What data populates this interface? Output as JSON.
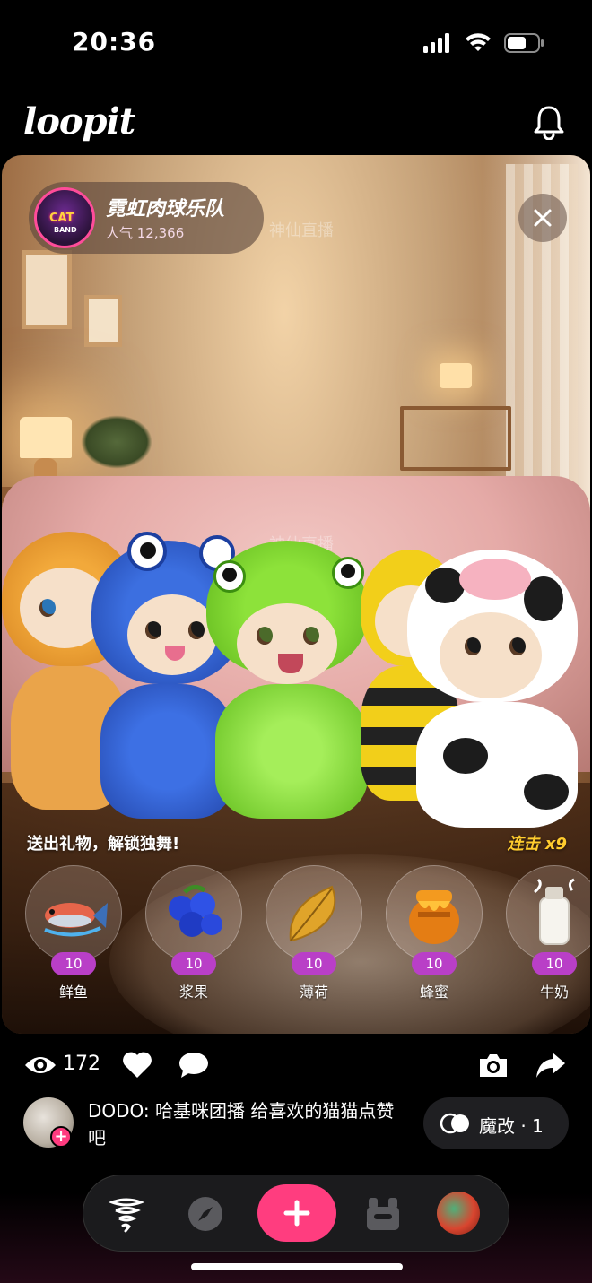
{
  "status_bar": {
    "time": "20:36"
  },
  "app": {
    "logo_text": "loopit"
  },
  "live": {
    "host_avatar_text_top": "CAT",
    "host_avatar_text_bottom": "BAND",
    "host_name": "霓虹肉球乐队",
    "popularity": "人气 12,366",
    "watermark": "神仙直播",
    "gift_prompt": "送出礼物，解锁独舞!",
    "combo": "连击 x9",
    "gifts": [
      {
        "name": "鲜鱼",
        "price": "10",
        "icon": "fish-icon"
      },
      {
        "name": "浆果",
        "price": "10",
        "icon": "berries-icon"
      },
      {
        "name": "薄荷",
        "price": "10",
        "icon": "leaf-icon"
      },
      {
        "name": "蜂蜜",
        "price": "10",
        "icon": "honey-pot-icon"
      },
      {
        "name": "牛奶",
        "price": "10",
        "icon": "milk-bottle-icon"
      }
    ]
  },
  "actions": {
    "view_count": "172",
    "icons": [
      "eye-icon",
      "heart-icon",
      "comment-icon",
      "camera-icon",
      "share-icon"
    ]
  },
  "comment": {
    "text": "DODO: 哈基咪团播 给喜欢的猫猫点赞吧",
    "plus": "+"
  },
  "remix": {
    "label": "魔改 · 1"
  },
  "nav": {
    "items": [
      "tornado-icon",
      "compass-icon",
      "plus-icon",
      "bot-icon",
      "profile-avatar"
    ],
    "create_label": "+"
  },
  "colors": {
    "accent": "#ff3d7f",
    "price_pill": "#b93fc7",
    "combo": "#ffcc2e",
    "host_ring": "#ff4c9a"
  }
}
